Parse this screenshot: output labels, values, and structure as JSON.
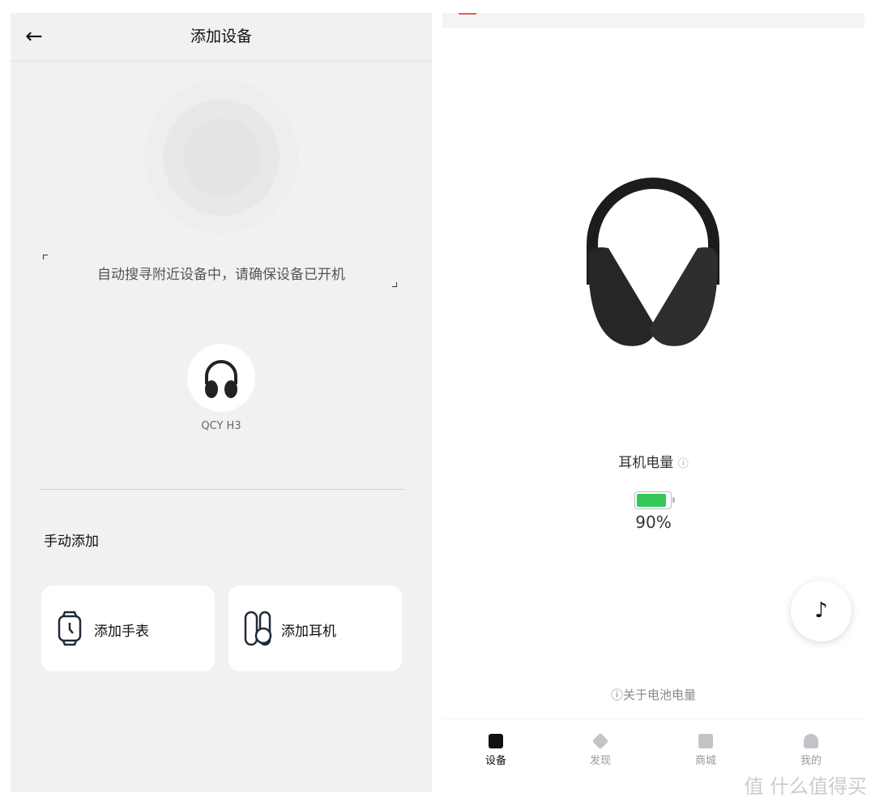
{
  "add_device": {
    "back_icon": "arrow-left-icon",
    "title": "添加设备",
    "search_status": "自动搜寻附近设备中，请确保设备已开机",
    "found_device": {
      "name": "QCY H3",
      "icon": "headphones-icon"
    },
    "manual_title": "手动添加",
    "cards": [
      {
        "label": "添加手表",
        "icon": "watch-icon"
      },
      {
        "label": "添加耳机",
        "icon": "earbuds-icon"
      }
    ]
  },
  "device": {
    "battery_label": "耳机电量",
    "battery_info_icon": "info-icon",
    "battery_percent": 90,
    "battery_text": "90%",
    "battery_color": "#34c759",
    "music_icon": "music-note-icon",
    "about_battery": "ⓘ关于电池电量",
    "tabs": [
      {
        "label": "设备",
        "icon": "device-icon",
        "active": true
      },
      {
        "label": "发现",
        "icon": "diamond-icon",
        "active": false
      },
      {
        "label": "商城",
        "icon": "shop-icon",
        "active": false
      },
      {
        "label": "我的",
        "icon": "person-icon",
        "active": false
      }
    ]
  },
  "watermark": "值 什么值得买"
}
